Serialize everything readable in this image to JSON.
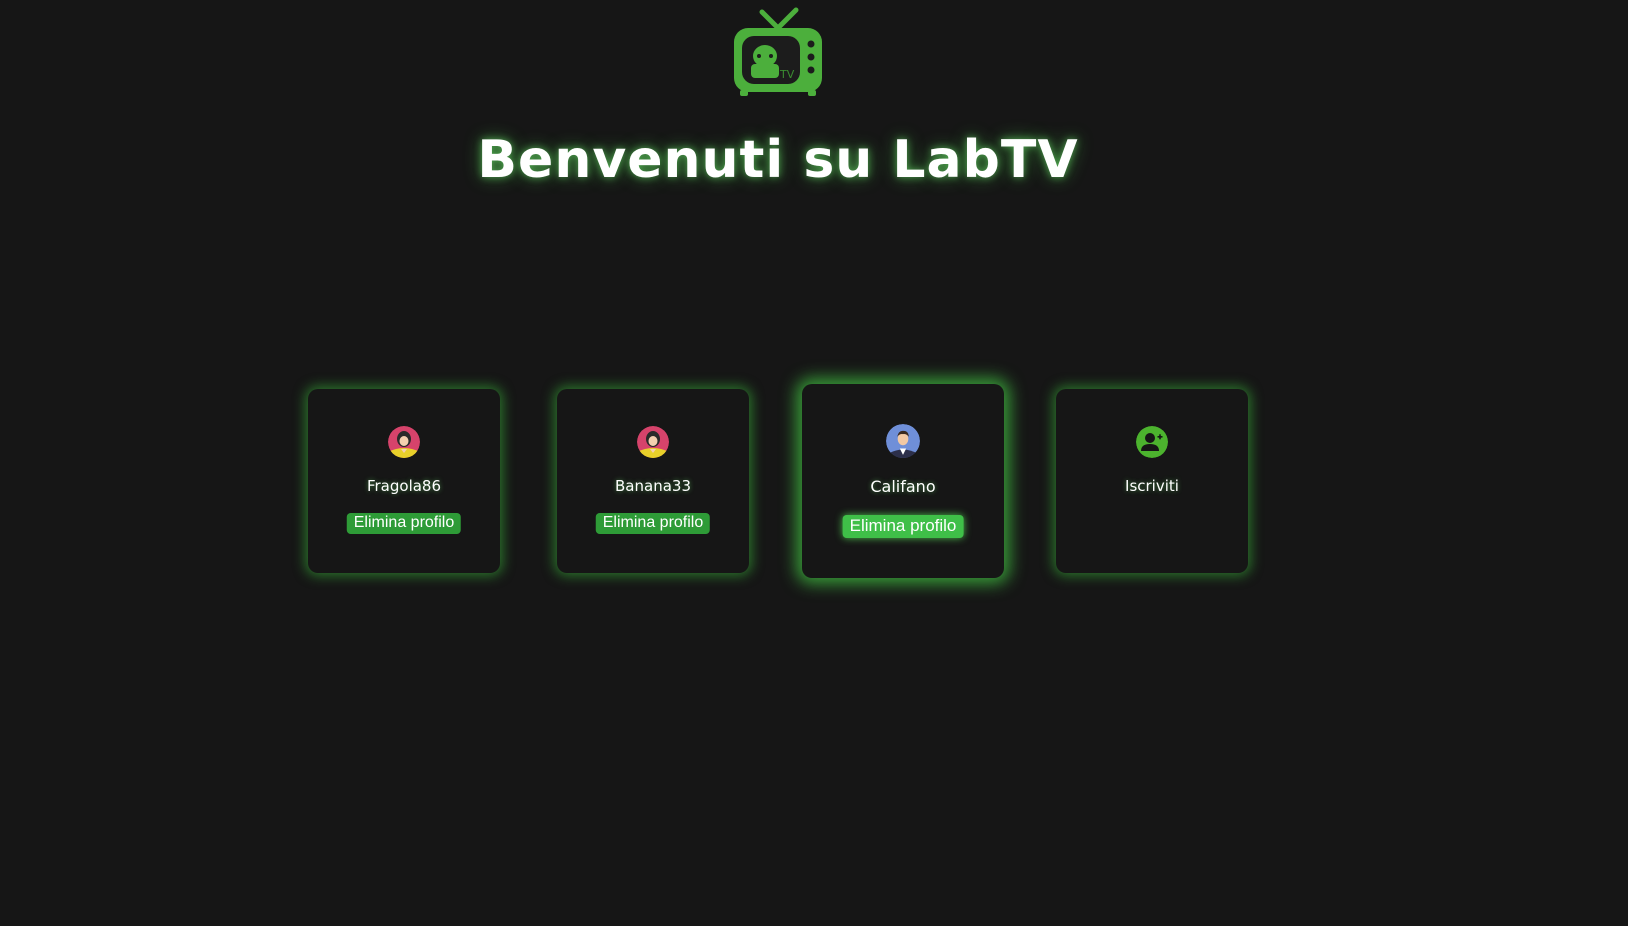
{
  "header": {
    "logo_icon": "labtv-tv-logo",
    "logo_text": "TV",
    "title": "Benvenuti su LabTV"
  },
  "colors": {
    "background": "#161616",
    "accent": "#4caf3c",
    "button": "#2e9b37",
    "button_active": "#3fbf48"
  },
  "profiles": [
    {
      "name": "Fragola86",
      "avatar_icon": "woman-avatar-icon",
      "delete_label": "Elimina profilo"
    },
    {
      "name": "Banana33",
      "avatar_icon": "woman-avatar-icon",
      "delete_label": "Elimina profilo"
    },
    {
      "name": "Califano",
      "avatar_icon": "man-avatar-icon",
      "delete_label": "Elimina profilo",
      "highlighted": true
    }
  ],
  "signup": {
    "label": "Iscriviti",
    "icon": "add-user-icon"
  }
}
